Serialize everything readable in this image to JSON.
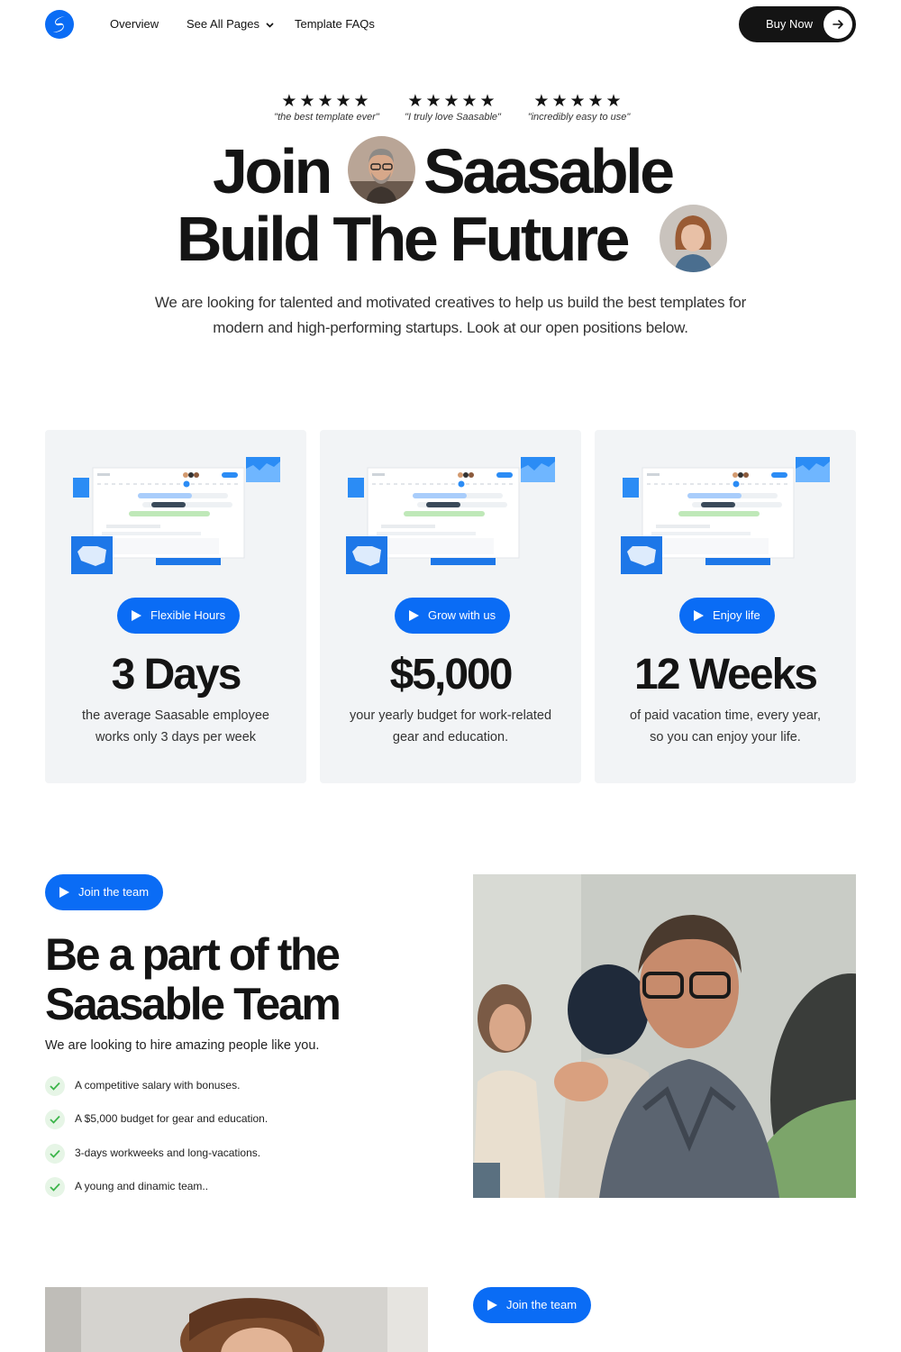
{
  "nav": {
    "links": [
      {
        "label": "Overview"
      },
      {
        "label": "See All Pages"
      },
      {
        "label": "Template FAQs"
      }
    ],
    "cta": "Buy Now"
  },
  "hero": {
    "reviews": [
      {
        "stars": "★★★★★",
        "quote": "\"the best template ever\""
      },
      {
        "stars": "★★★★★",
        "quote": "\"I truly love Saasable\""
      },
      {
        "stars": "★★★★★",
        "quote": "\"incredibly easy to use\""
      }
    ],
    "title_line1_a": "Join",
    "title_line1_b": "Saasable",
    "title_line2": "Build The Future",
    "description": "We are looking for talented and motivated creatives to help us build the best templates for modern and high-performing startups. Look at our open positions below."
  },
  "cards": [
    {
      "pill": "Flexible Hours",
      "stat": "3 Days",
      "desc": "the average Saasable employee works only 3 days per week"
    },
    {
      "pill": "Grow with us",
      "stat": "$5,000",
      "desc": "your yearly budget for work-related gear and education."
    },
    {
      "pill": "Enjoy life",
      "stat": "12 Weeks",
      "desc": "of paid vacation time, every year, so you can enjoy your life."
    }
  ],
  "team": {
    "pill": "Join the team",
    "title_line1": "Be a part of the",
    "title_line2": "Saasable Team",
    "subtitle": "We are looking to hire amazing people like you.",
    "benefits": [
      "A competitive salary with  bonuses.",
      "A $5,000 budget for gear and education.",
      "3-days workweeks and long-vacations.",
      "A young and dinamic team.."
    ]
  },
  "next_section": {
    "pill": "Join the team"
  },
  "colors": {
    "accent": "#0a6cf5",
    "dark": "#141414",
    "card_bg": "#f2f4f6",
    "check_bg": "#e6f5e6"
  }
}
